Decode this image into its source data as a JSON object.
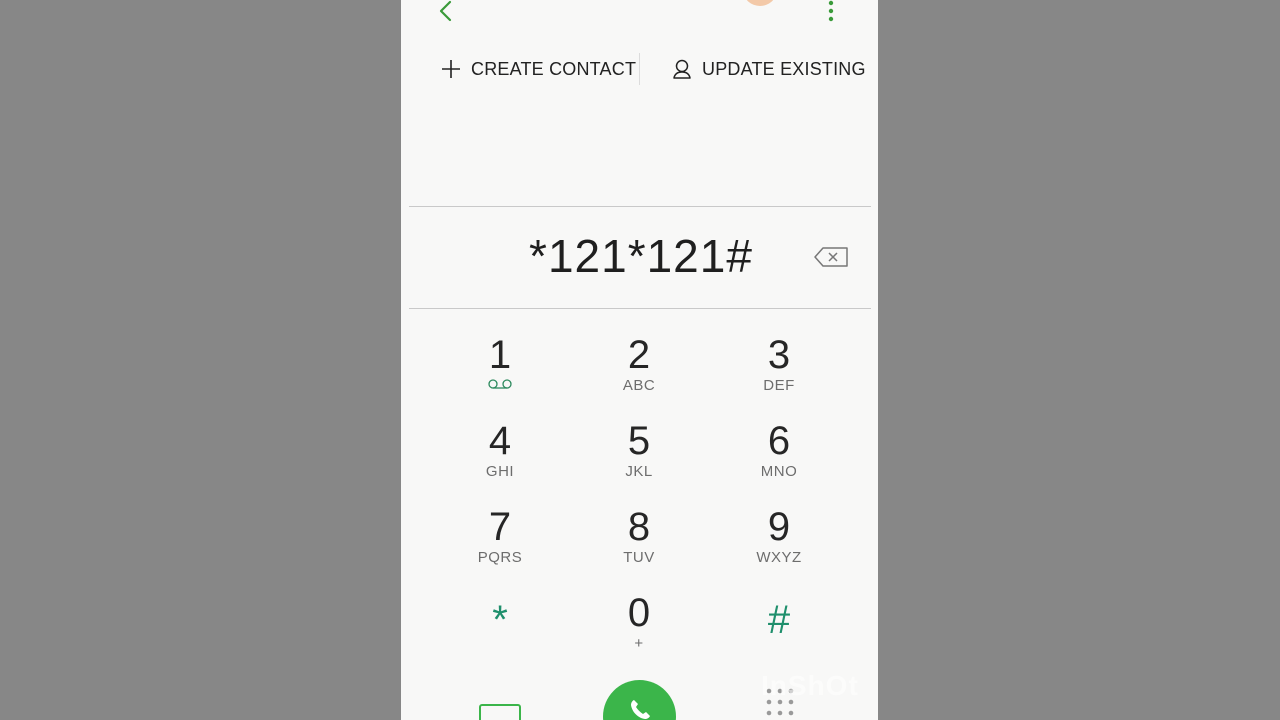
{
  "toolbar": {
    "back_icon": "chevron-left-icon",
    "more_icon": "more-vertical-icon",
    "accent_color": "#3a9a3a"
  },
  "actions": {
    "create_contact": "CREATE CONTACT",
    "update_existing": "UPDATE EXISTING"
  },
  "dialer": {
    "number": "*121*121#"
  },
  "keypad": [
    {
      "digit": "1",
      "letters": ""
    },
    {
      "digit": "2",
      "letters": "ABC"
    },
    {
      "digit": "3",
      "letters": "DEF"
    },
    {
      "digit": "4",
      "letters": "GHI"
    },
    {
      "digit": "5",
      "letters": "JKL"
    },
    {
      "digit": "6",
      "letters": "MNO"
    },
    {
      "digit": "7",
      "letters": "PQRS"
    },
    {
      "digit": "8",
      "letters": "TUV"
    },
    {
      "digit": "9",
      "letters": "WXYZ"
    },
    {
      "digit": "*",
      "letters": ""
    },
    {
      "digit": "0",
      "letters": "+"
    },
    {
      "digit": "#",
      "letters": ""
    }
  ],
  "call": {
    "button_color": "#3bb54a"
  },
  "watermark": "InShOt"
}
